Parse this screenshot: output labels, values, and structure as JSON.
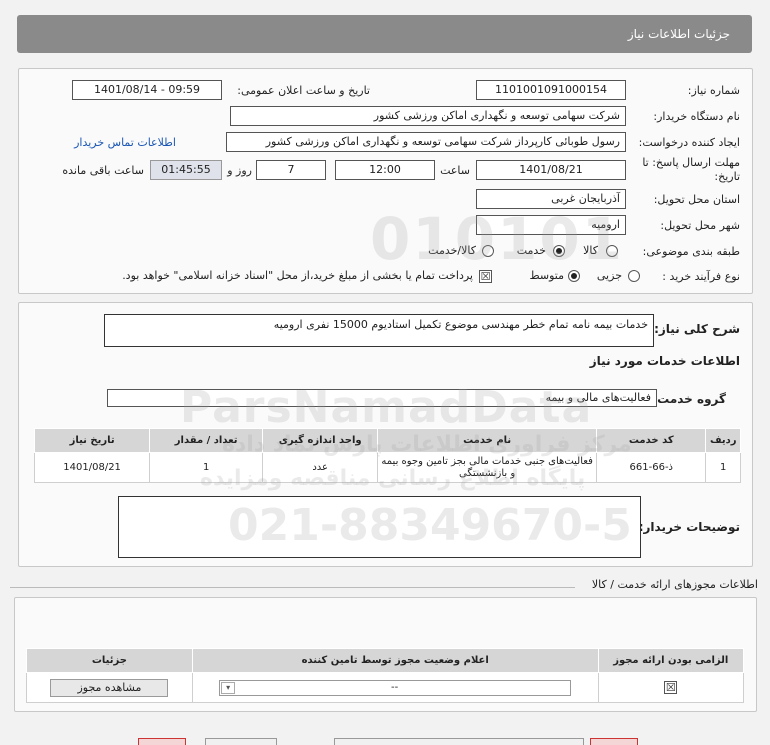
{
  "header": {
    "title": "جزئیات اطلاعات نیاز"
  },
  "form": {
    "need_number_label": "شماره نیاز:",
    "need_number": "1101001091000154",
    "announce_label": "تاریخ و ساعت اعلان عمومی:",
    "announce_value": "1401/08/14 - 09:59",
    "buyer_label": "نام دستگاه خریدار:",
    "buyer_value": "شرکت سهامی توسعه و نگهداری اماکن ورزشی کشور",
    "creator_label": "ایجاد کننده درخواست:",
    "creator_value": "رسول طوبائی کارپرداز شرکت سهامی توسعه و نگهداری اماکن ورزشی کشور",
    "contact_link": "اطلاعات تماس خریدار",
    "deadline_label_1": "مهلت ارسال پاسخ: تا",
    "deadline_label_2": "تاریخ:",
    "deadline_date": "1401/08/21",
    "time_label": "ساعت",
    "deadline_time": "12:00",
    "days_value": "7",
    "days_label": "روز و",
    "remaining_time": "01:45:55",
    "remaining_label": "ساعت باقی مانده",
    "province_label": "استان محل تحویل:",
    "province_value": "آذربایجان غربی",
    "city_label": "شهر محل تحویل:",
    "city_value": "ارومیه",
    "category_label": "طبقه بندی موضوعی:",
    "category_options": [
      "کالا",
      "خدمت",
      "کالا/خدمت"
    ],
    "process_label": "نوع فرآیند خرید :",
    "process_options": [
      "جزیی",
      "متوسط"
    ],
    "payment_note": "پرداخت تمام یا بخشی از مبلغ خرید،از محل \"اسناد خزانه اسلامی\" خواهد بود."
  },
  "description": {
    "title_label": "شرح کلی نیاز:",
    "title_value": "خدمات بیمه نامه تمام خطر مهندسی موضوع تکمیل استادیوم 15000 نفری ارومیه",
    "services_heading": "اطلاعات خدمات مورد نیاز",
    "group_label": "گروه خدمت:",
    "group_value": "فعالیت‌های مالی و بیمه",
    "table_headers": [
      "ردیف",
      "کد خدمت",
      "نام خدمت",
      "واحد اندازه گیری",
      "تعداد / مقدار",
      "تاریخ نیاز"
    ],
    "table_rows": [
      [
        "1",
        "ذ-66-661",
        "فعالیت‌های جنبی خدمات مالی بجز تامین وجوه بیمه و بازنشستگی",
        "عدد",
        "1",
        "1401/08/21"
      ]
    ],
    "buyer_notes_label": "توضیحات خریدار:"
  },
  "permits": {
    "heading": "اطلاعات مجوزهای ارائه خدمت / کالا",
    "table_headers": [
      "الزامی بودن ارائه مجوز",
      "اعلام وضعیت مجوز توسط تامین کننده",
      "جزئیات"
    ],
    "status_value": "--",
    "view_button": "مشاهده مجوز"
  },
  "watermark": {
    "line1": "ParsNamadData",
    "line2": "مرکز فراوری اطلاعات پارس نماد داده",
    "line3": "پایگاه اطلاع رسانی مناقصه ومزایده",
    "phone": "021-88349670-5",
    "digits": "010101"
  }
}
